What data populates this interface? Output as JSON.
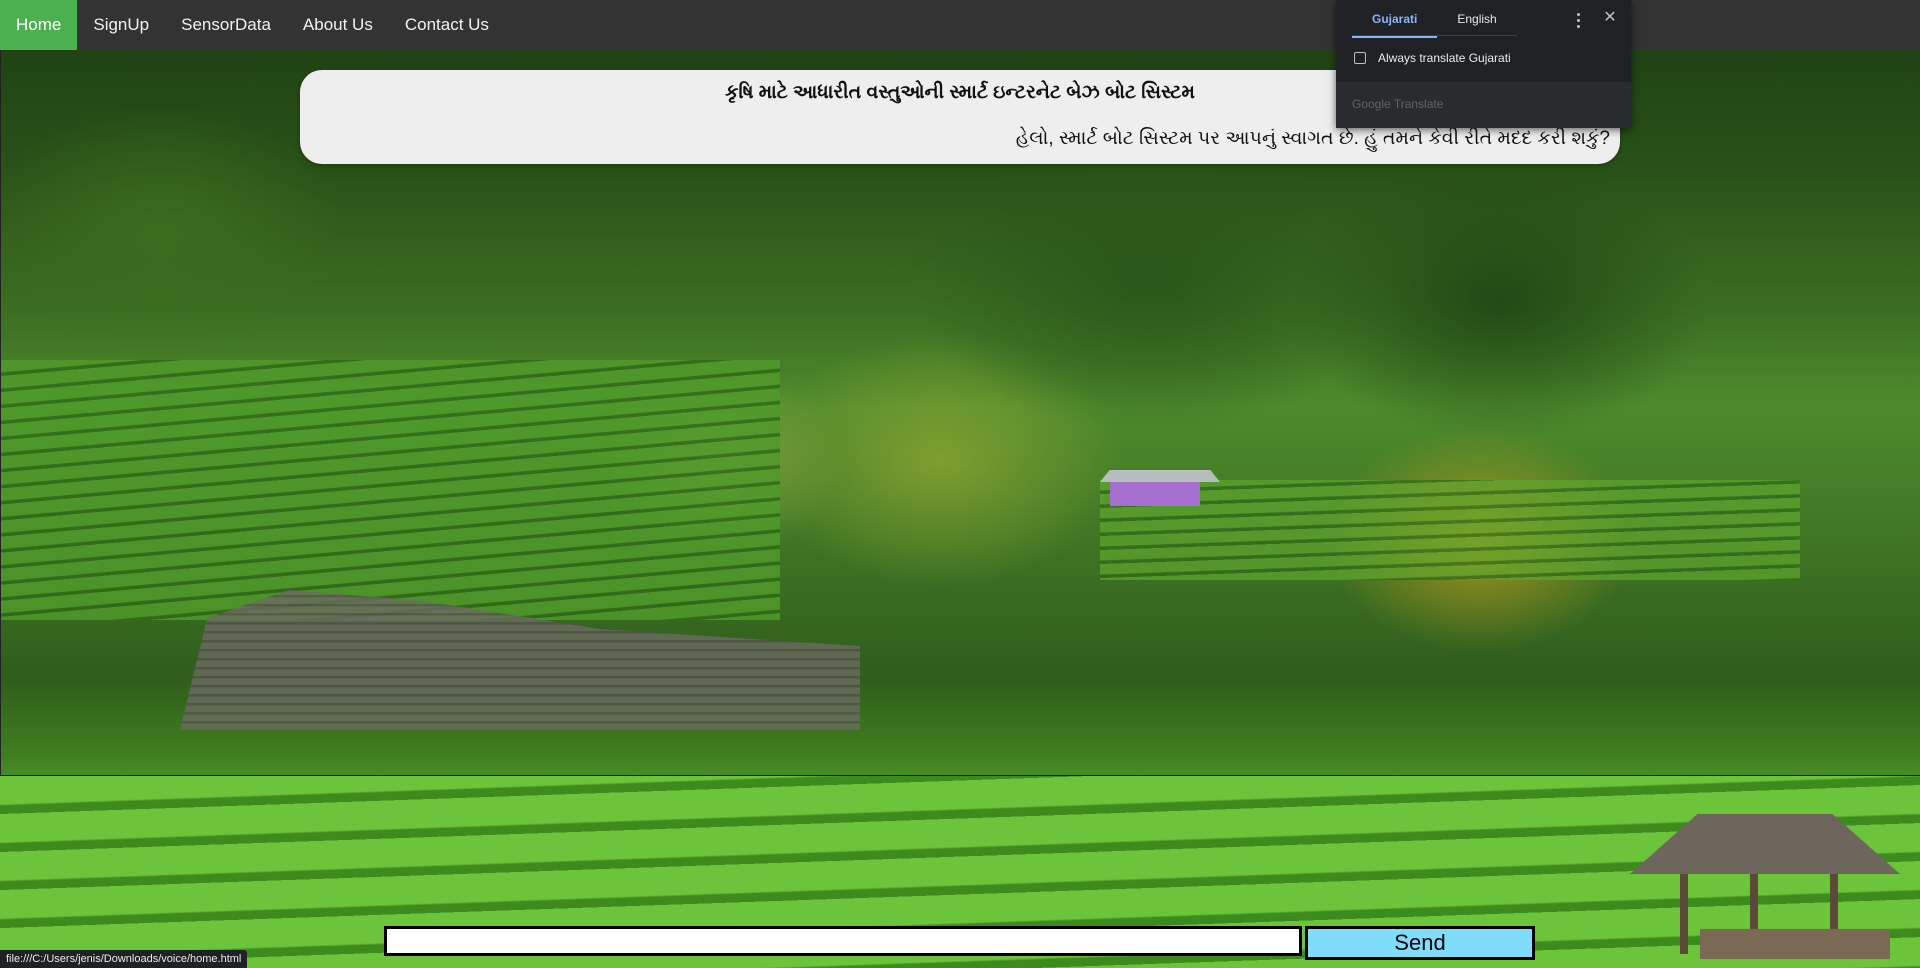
{
  "nav": {
    "items": [
      {
        "label": "Home",
        "active": true
      },
      {
        "label": "SignUp",
        "active": false
      },
      {
        "label": "SensorData",
        "active": false
      },
      {
        "label": "About Us",
        "active": false
      },
      {
        "label": "Contact Us",
        "active": false
      }
    ],
    "bar_color": "#333333",
    "active_color": "#4caf50"
  },
  "chat": {
    "title": "કૃષિ માટે આધારીત વસ્તુઓની સ્માર્ટ ઇન્ટરનેટ બેઝ બોટ સિસ્ટમ",
    "message": "હેલો, સ્માર્ટ બોટ સિસ્ટમ પર આપનું સ્વાગત છે. હું તમને કેવી રીતે મદદ કરી શકું?",
    "input_value": "",
    "send_label": "Send",
    "send_color": "#7fdcfa"
  },
  "translate_popup": {
    "tabs": [
      "Gujarati",
      "English"
    ],
    "active_tab": "Gujarati",
    "always_translate_label": "Always translate Gujarati",
    "always_translate_checked": false,
    "brand": "Google Translate",
    "icons": {
      "more": "more-vert-icon",
      "close": "close-icon"
    },
    "accent_color": "#8ab4f8"
  },
  "status_bar": {
    "url": "file:///C:/Users/jenis/Downloads/voice/home.html"
  }
}
